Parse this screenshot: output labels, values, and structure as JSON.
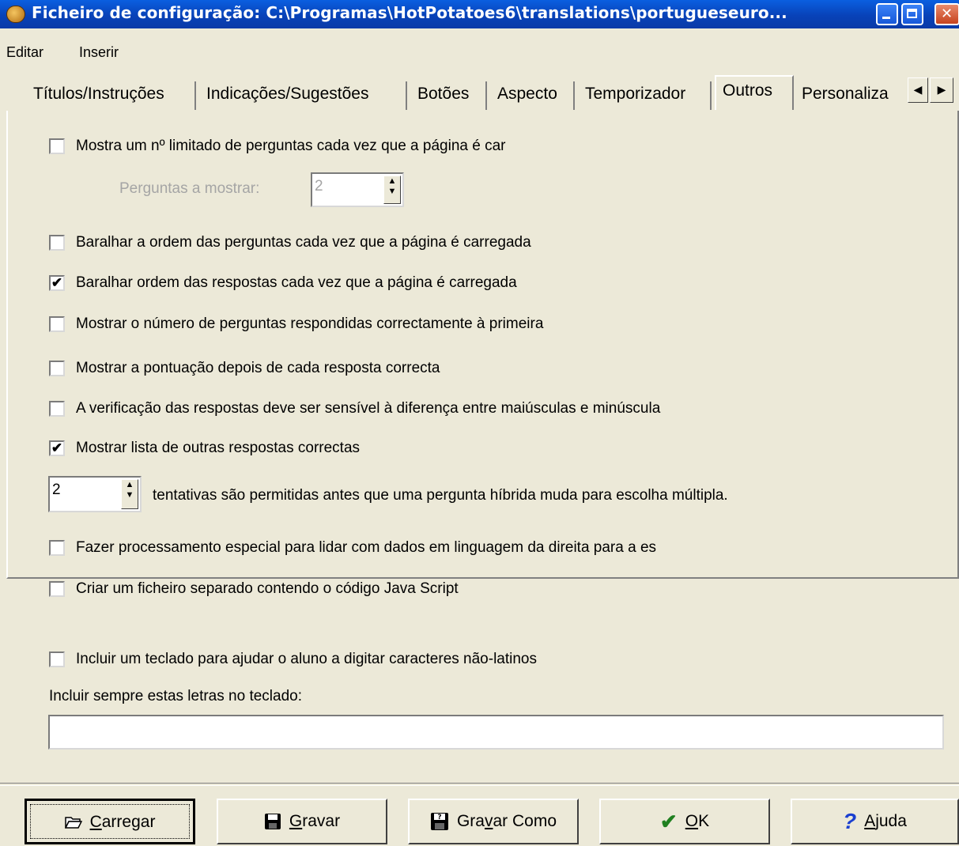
{
  "window": {
    "title": "Ficheiro de configuração: C:\\Programas\\HotPotatoes6\\translations\\portugueseuro..."
  },
  "menu": {
    "items": [
      "Editar",
      "Inserir"
    ]
  },
  "tabs": {
    "items": [
      "Títulos/Instruções",
      "Indicações/Sugestões",
      "Botões",
      "Aspecto",
      "Temporizador",
      "Outros",
      "Personalizar"
    ],
    "active": "Outros",
    "scroll_left": "◀",
    "scroll_right": "▶"
  },
  "options": {
    "limit_questions": {
      "label": "Mostra um nº limitado de perguntas cada vez que a página é car",
      "checked": false
    },
    "questions_to_show": {
      "label": "Perguntas a mostrar:",
      "value": "2"
    },
    "shuffle_questions": {
      "label": "Baralhar a ordem das perguntas cada vez que a página é carregada",
      "checked": false
    },
    "shuffle_answers": {
      "label": "Baralhar ordem das respostas cada vez que a página é carregada",
      "checked": true
    },
    "show_correct_first": {
      "label": "Mostrar o  número de perguntas respondidas correctamente à primeira",
      "checked": false
    },
    "show_score": {
      "label": "Mostrar a pontuação depois de cada resposta correcta",
      "checked": false
    },
    "case_sensitive": {
      "label": "A verificação das respostas deve ser sensível à diferença entre maiúsculas e minúscula",
      "checked": false
    },
    "show_other_answers": {
      "label": "Mostrar lista de outras respostas correctas",
      "checked": true
    },
    "attempts": {
      "value": "2",
      "label": "tentativas são permitidas antes que uma pergunta híbrida muda para escolha múltipla."
    },
    "rtl_processing": {
      "label": "Fazer processamento especial para lidar com dados em linguagem da direita para a es",
      "checked": false
    },
    "separate_js": {
      "label": "Criar um ficheiro separado contendo o código Java Script",
      "checked": false
    },
    "keyboard": {
      "label": "Incluir um teclado para ajudar o aluno a digitar caracteres não-latinos",
      "checked": false
    },
    "keyboard_letters": {
      "label": "Incluir sempre estas letras no teclado:",
      "value": ""
    }
  },
  "buttons": {
    "load": {
      "pre": "",
      "u": "C",
      "post": "arregar"
    },
    "save": {
      "pre": "",
      "u": "G",
      "post": "ravar"
    },
    "save_as": {
      "pre": "Gra",
      "u": "v",
      "post": "ar Como"
    },
    "ok": {
      "pre": "",
      "u": "O",
      "post": "K"
    },
    "help": {
      "pre": "",
      "u": "A",
      "post": "juda"
    }
  },
  "icons": {
    "check_mark": "✔",
    "question_mark": "?",
    "spin_up": "▲",
    "spin_down": "▼"
  }
}
